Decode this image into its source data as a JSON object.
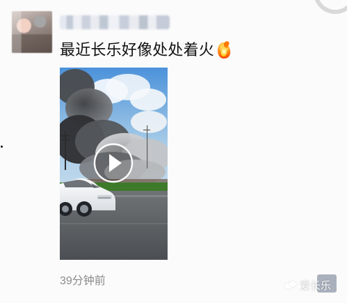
{
  "post": {
    "text": "最近长乐好像处处着火",
    "timestamp": "39分钟前"
  },
  "icons": {
    "avatar": "avatar-image",
    "fire": "fire-icon",
    "video": "play-icon",
    "watermark": "chat-bubbles-icon"
  },
  "watermark": {
    "text": "爱长乐"
  },
  "colors": {
    "background": "#fbfbfb",
    "text": "#111111",
    "muted": "#8a8a8a",
    "fire": "#ff6a00"
  }
}
